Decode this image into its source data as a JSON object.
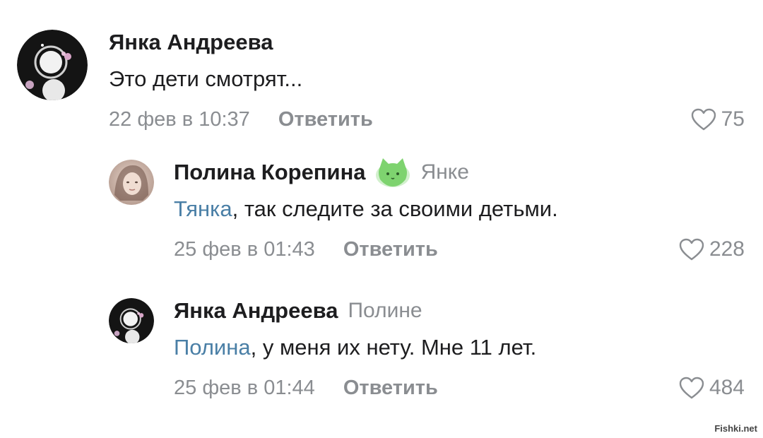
{
  "comments": [
    {
      "author": "Янка Андреева",
      "reply_to": "",
      "text": "Это дети смотрят...",
      "date": "22 фев в 10:37",
      "reply_label": "Ответить",
      "likes": "75",
      "avatar": "dark-avatar-with-white-circles"
    },
    {
      "author": "Полина Корепина",
      "badge": "green-cat-sticker-icon",
      "reply_to": "Янке",
      "mention": "Тянка",
      "text": ", так следите за своими детьми.",
      "date": "25 фев в 01:43",
      "reply_label": "Ответить",
      "likes": "228",
      "avatar": "photo-avatar-girl"
    },
    {
      "author": "Янка Андреева",
      "reply_to": "Полине",
      "mention": "Полина",
      "text": ", у меня их нету. Мне 11 лет.",
      "date": "25 фев в 01:44",
      "reply_label": "Ответить",
      "likes": "484",
      "avatar": "dark-avatar-with-white-circles"
    }
  ],
  "watermark": "Fishki.net",
  "colors": {
    "text": "#1d1d1f",
    "muted": "#8a8d91",
    "mention": "#4a7fa6",
    "badge_green": "#7ed36f"
  }
}
